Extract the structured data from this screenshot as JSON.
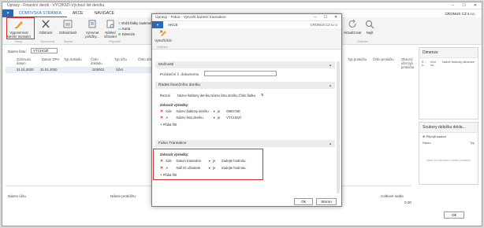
{
  "main_window": {
    "title": "Úpravy - Finanční deník - VÝCHOZÍ-Výchozí list deníku",
    "tabs": [
      "DOMOVSKÁ STRÁNKA",
      "AKCE",
      "NAVIGACE"
    ],
    "company": "CRONUS CZ s.r.o.",
    "ribbon_buttons": {
      "generate": "Vygenerovat karetní transakci",
      "delete": "Odstranit",
      "reconcile": "Odsouhlasit",
      "balance": "Vyrovnat položky...",
      "preview": "Náhled účtování",
      "insert_rows": "Vložit řádky zaokrouhlení",
      "card": "Karta",
      "dimensions": "Dimenze",
      "refresh": "Aktualizovat",
      "find": "Najít"
    },
    "ribbon_groups": [
      "Nový",
      "Spravovat",
      "Banka",
      "Připravit",
      "Stránka"
    ],
    "batch_label": "Název listu:",
    "batch_value": "VÝCHOZÍ",
    "grid_headers": [
      "Zúčtovací datum",
      "Datum DPH",
      "Typ dokladu",
      "Číslo dokladu",
      "Typ účtu",
      "Číslo účtu",
      "Typ protiúčtu",
      "Číslo protiúčtu",
      "Obecný účet typ protiúčtu"
    ],
    "grid_row": {
      "posting_date": "31.01.2020",
      "vat_date": "31.01.2020",
      "doc_no": "G00001",
      "account_type": "Účet"
    },
    "footer_labels": {
      "account_name": "Název účtu",
      "contra_name": "Název protiúčtu",
      "total_balance": "Celkové saldo",
      "total_value": "0,00"
    },
    "ok": "Ok"
  },
  "factbox": {
    "dimensions_title": "Dimenze",
    "dimensions_cols": [
      "K... k...",
      "Kód ho...",
      "Název hodnoty dimenze"
    ],
    "docs_title": "Soubory doložku dokla...",
    "attach": "Připojit soubor",
    "docs_cols": [
      "Název",
      "Typ"
    ],
    "docs_empty": "Není co zobrazit v tomto pohledu"
  },
  "dialog": {
    "title": "Úpravy - Fidoo - Vytvořit karetní transakce",
    "tab": "AKCE",
    "company": "CRONUS CZ s.r.o.",
    "create_button": "Vytvořit fido",
    "create_group": "Stránka",
    "options_title": "Možnosti",
    "counter_label": "Počáteční č. dokumentu",
    "journal_title": "Řádek finančního deníku",
    "sort_label": "Řazení",
    "sort_value": "Název šablony deníku,Název listu deníku,Číslo řádku",
    "show_results": "Zobrazit výsledky:",
    "journal_filters": [
      {
        "prefix": "Kde",
        "field": "Název šablony deníku",
        "op": "je",
        "value": "OBECNÉ"
      },
      {
        "prefix": "A",
        "field": "Název listu deníku",
        "op": "je",
        "value": "VÝCHOZÍ"
      }
    ],
    "add_filter": "Přidat filtr",
    "fidoo_title": "Fidoo Transakce",
    "fidoo_filters": [
      {
        "prefix": "Kde",
        "field": "Datum transakce",
        "op": "je",
        "value": "Zadejte hodnotu."
      },
      {
        "prefix": "A",
        "field": "Náš ID uživatele",
        "op": "je",
        "value": "Zadejte hodnotu."
      }
    ],
    "ok": "Ok",
    "cancel": "Storno"
  },
  "colors": {
    "accent": "#2c69b4",
    "highlight": "#d9302f"
  }
}
